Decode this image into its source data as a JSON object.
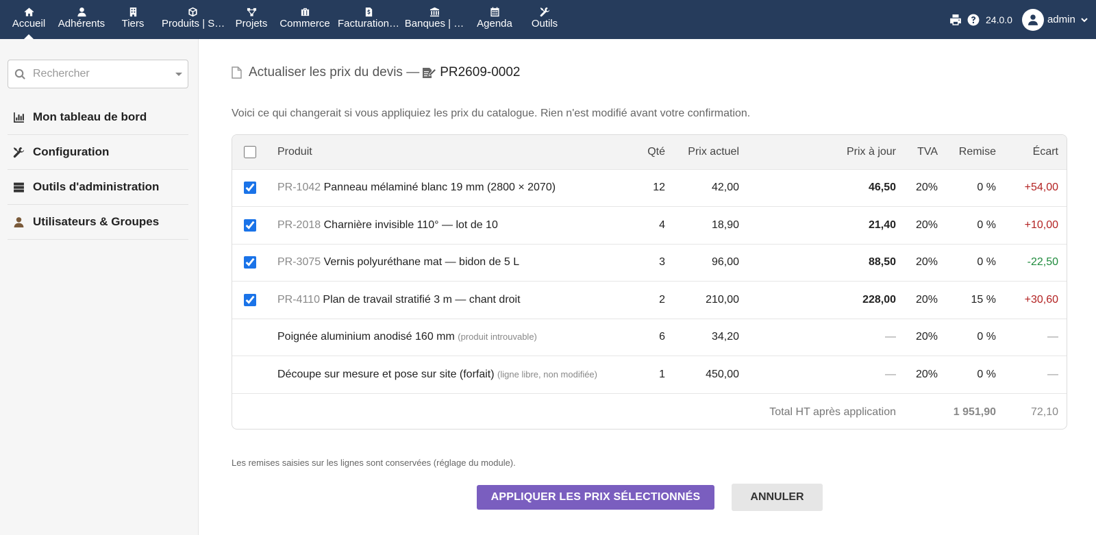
{
  "topbar": {
    "menu": [
      {
        "label": "Accueil",
        "icon": "home-icon"
      },
      {
        "label": "Adhérents",
        "icon": "user-icon"
      },
      {
        "label": "Tiers",
        "icon": "building-icon"
      },
      {
        "label": "Produits | S…",
        "icon": "cube-icon"
      },
      {
        "label": "Projets",
        "icon": "project-icon"
      },
      {
        "label": "Commerce",
        "icon": "briefcase-icon"
      },
      {
        "label": "Facturation…",
        "icon": "invoice-icon"
      },
      {
        "label": "Banques | …",
        "icon": "bank-icon"
      },
      {
        "label": "Agenda",
        "icon": "calendar-icon"
      },
      {
        "label": "Outils",
        "icon": "tools-icon"
      }
    ],
    "active_index": 0,
    "version": "24.0.0",
    "username": "admin"
  },
  "sidebar": {
    "search_placeholder": "Rechercher",
    "items": [
      {
        "label": "Mon tableau de bord",
        "icon": "chart-icon"
      },
      {
        "label": "Configuration",
        "icon": "tools-icon"
      },
      {
        "label": "Outils d'administration",
        "icon": "server-icon"
      },
      {
        "label": "Utilisateurs & Groupes",
        "icon": "user-icon"
      }
    ]
  },
  "main": {
    "title": "Actualiser les prix du devis —",
    "ref": "PR2609-0002",
    "intro": "Voici ce qui changerait si vous appliquiez les prix du catalogue. Rien n'est modifié avant votre confirmation.",
    "table": {
      "headers": {
        "product": "Produit",
        "qty": "Qté",
        "current": "Prix actuel",
        "new": "Prix à jour",
        "vat": "TVA",
        "discount": "Remise",
        "diff": "Écart"
      },
      "rows": [
        {
          "checked": true,
          "ref": "PR-1042",
          "name": "Panneau mélaminé blanc 19 mm (2800 × 2070)",
          "note": "",
          "qty": "12",
          "current": "42,00",
          "new": "46,50",
          "vat": "20%",
          "discount": "0 %",
          "diff": "+54,00",
          "diff_type": "pos"
        },
        {
          "checked": true,
          "ref": "PR-2018",
          "name": "Charnière invisible 110° — lot de 10",
          "note": "",
          "qty": "4",
          "current": "18,90",
          "new": "21,40",
          "vat": "20%",
          "discount": "0 %",
          "diff": "+10,00",
          "diff_type": "pos"
        },
        {
          "checked": true,
          "ref": "PR-3075",
          "name": "Vernis polyuréthane mat — bidon de 5 L",
          "note": "",
          "qty": "3",
          "current": "96,00",
          "new": "88,50",
          "vat": "20%",
          "discount": "0 %",
          "diff": "-22,50",
          "diff_type": "neg"
        },
        {
          "checked": true,
          "ref": "PR-4110",
          "name": "Plan de travail stratifié 3 m — chant droit",
          "note": "",
          "qty": "2",
          "current": "210,00",
          "new": "228,00",
          "vat": "20%",
          "discount": "15 %",
          "diff": "+30,60",
          "diff_type": "pos"
        },
        {
          "checked": null,
          "ref": "",
          "name": "Poignée aluminium anodisé 160 mm",
          "note": "(produit introuvable)",
          "qty": "6",
          "current": "34,20",
          "new": "—",
          "vat": "20%",
          "discount": "0 %",
          "diff": "—",
          "diff_type": "none"
        },
        {
          "checked": null,
          "ref": "",
          "name": "Découpe sur mesure et pose sur site (forfait)",
          "note": "(ligne libre, non modifiée)",
          "qty": "1",
          "current": "450,00",
          "new": "—",
          "vat": "20%",
          "discount": "0 %",
          "diff": "—",
          "diff_type": "none"
        }
      ],
      "total_label": "Total HT après application",
      "total_ht": "1 951,90",
      "total_diff": "72,10"
    },
    "footnote": "Les remises saisies sur les lignes sont conservées (réglage du module).",
    "apply_label": "APPLIQUER LES PRIX SÉLECTIONNÉS",
    "cancel_label": "ANNULER"
  }
}
